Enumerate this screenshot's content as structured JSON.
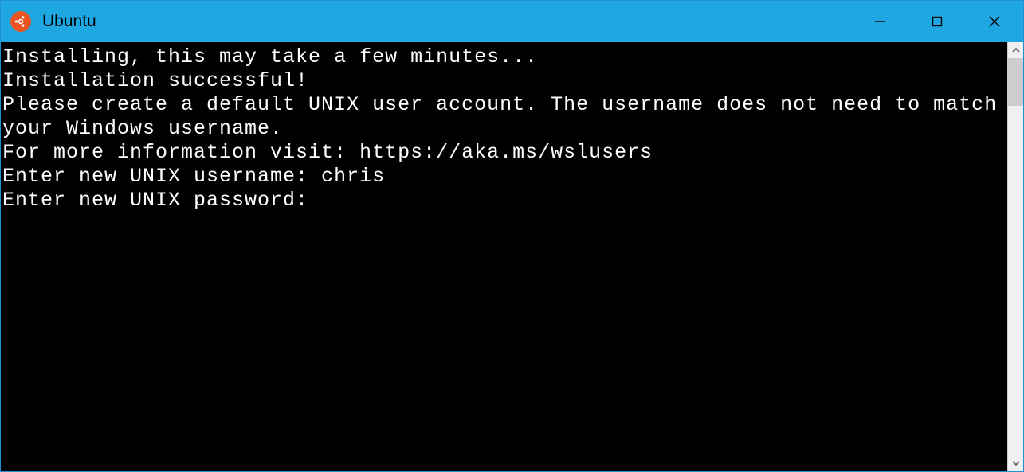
{
  "window": {
    "title": "Ubuntu",
    "icon": "ubuntu-logo-icon",
    "controls": {
      "minimize": "minimize-icon",
      "maximize": "maximize-icon",
      "close": "close-icon"
    }
  },
  "terminal": {
    "lines": [
      "Installing, this may take a few minutes...",
      "Installation successful!",
      "Please create a default UNIX user account. The username does not need to match your Windows username.",
      "For more information visit: https://aka.ms/wslusers",
      "Enter new UNIX username: chris",
      "Enter new UNIX password:"
    ],
    "prompt_username_value": "chris"
  },
  "colors": {
    "titlebar_bg": "#1ea7e1",
    "terminal_bg": "#000000",
    "terminal_fg": "#ffffff",
    "ubuntu_icon_bg": "#e95420"
  }
}
